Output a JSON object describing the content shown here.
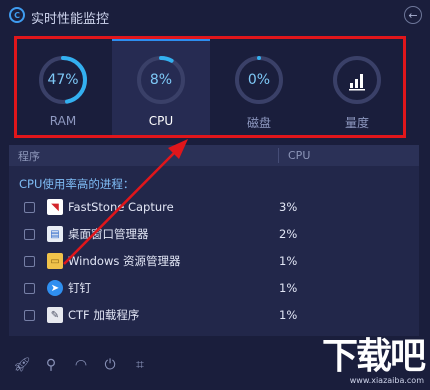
{
  "app": {
    "title": "实时性能监控",
    "logo_icon": "c-logo-icon",
    "back_icon": "back-arrow-icon"
  },
  "metrics": [
    {
      "label": "RAM",
      "value": "47%",
      "percent": 0.47,
      "active": false
    },
    {
      "label": "CPU",
      "value": "8%",
      "percent": 0.08,
      "active": true
    },
    {
      "label": "磁盘",
      "value": "0%",
      "percent": 0.0,
      "active": false
    },
    {
      "label": "量度",
      "value": "",
      "icon": "bar-chart-icon",
      "active": false
    }
  ],
  "table": {
    "col_name": "程序",
    "col_cpu": "CPU",
    "caption": "CPU使用率高的进程：",
    "rows": [
      {
        "name": "FastStone Capture",
        "cpu": "3%",
        "icon": "faststone-icon",
        "checked": false
      },
      {
        "name": "桌面窗口管理器",
        "cpu": "2%",
        "icon": "window-manager-icon",
        "checked": false
      },
      {
        "name": "Windows 资源管理器",
        "cpu": "1%",
        "icon": "folder-icon",
        "checked": false
      },
      {
        "name": "钉钉",
        "cpu": "1%",
        "icon": "dingtalk-icon",
        "checked": false
      },
      {
        "name": "CTF 加载程序",
        "cpu": "1%",
        "icon": "ctf-loader-icon",
        "checked": false
      }
    ]
  },
  "toolbar": {
    "icons": [
      "rocket-icon",
      "search-icon",
      "speed-icon",
      "power-icon",
      "crop-icon"
    ]
  },
  "watermark": {
    "main": "下载吧",
    "url": "www.xiazaiba.com"
  },
  "colors": {
    "accent": "#2d8ef0",
    "highlight": "#e0161b",
    "background": "#1a1e3c"
  }
}
